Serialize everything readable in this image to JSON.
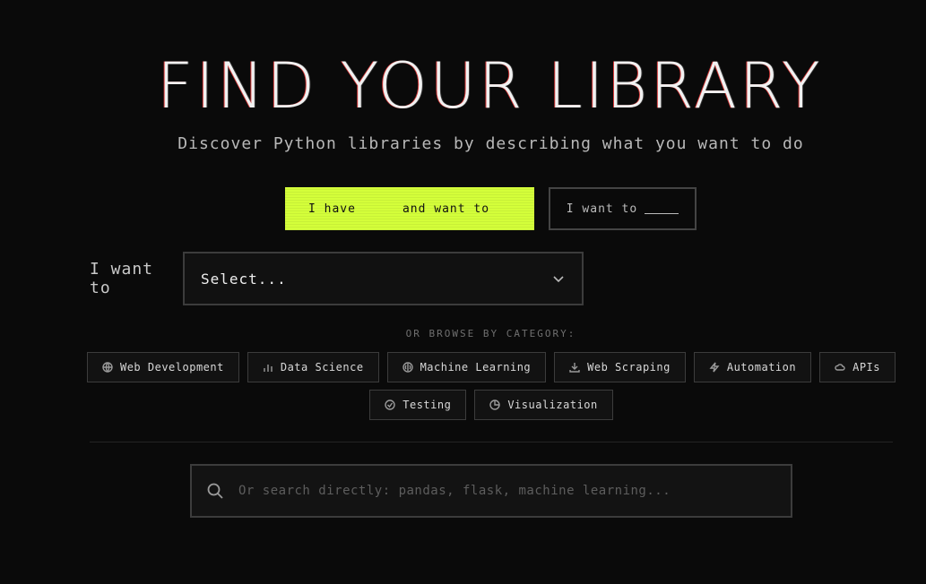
{
  "header": {
    "title": "FIND YOUR LIBRARY",
    "subtitle": "Discover Python libraries by describing what you want to do"
  },
  "mode_toggle": {
    "active_part1": "I have",
    "active_part2": "and want to",
    "inactive_label": "I want to"
  },
  "want_row": {
    "label": "I want to",
    "select_value": "Select..."
  },
  "browse": {
    "label": "OR BROWSE BY CATEGORY:",
    "categories": [
      {
        "label": "Web Development",
        "icon": "globe-icon"
      },
      {
        "label": "Data Science",
        "icon": "bar-chart-icon"
      },
      {
        "label": "Machine Learning",
        "icon": "brain-icon"
      },
      {
        "label": "Web Scraping",
        "icon": "download-icon"
      },
      {
        "label": "Automation",
        "icon": "lightning-icon"
      },
      {
        "label": "APIs",
        "icon": "cloud-icon"
      },
      {
        "label": "Testing",
        "icon": "check-circle-icon"
      },
      {
        "label": "Visualization",
        "icon": "pie-chart-icon"
      }
    ]
  },
  "search": {
    "placeholder": "Or search directly: pandas, flask, machine learning..."
  },
  "colors": {
    "background": "#0a0a0a",
    "accent": "#d4ff3a",
    "border": "#3c3c3c"
  }
}
